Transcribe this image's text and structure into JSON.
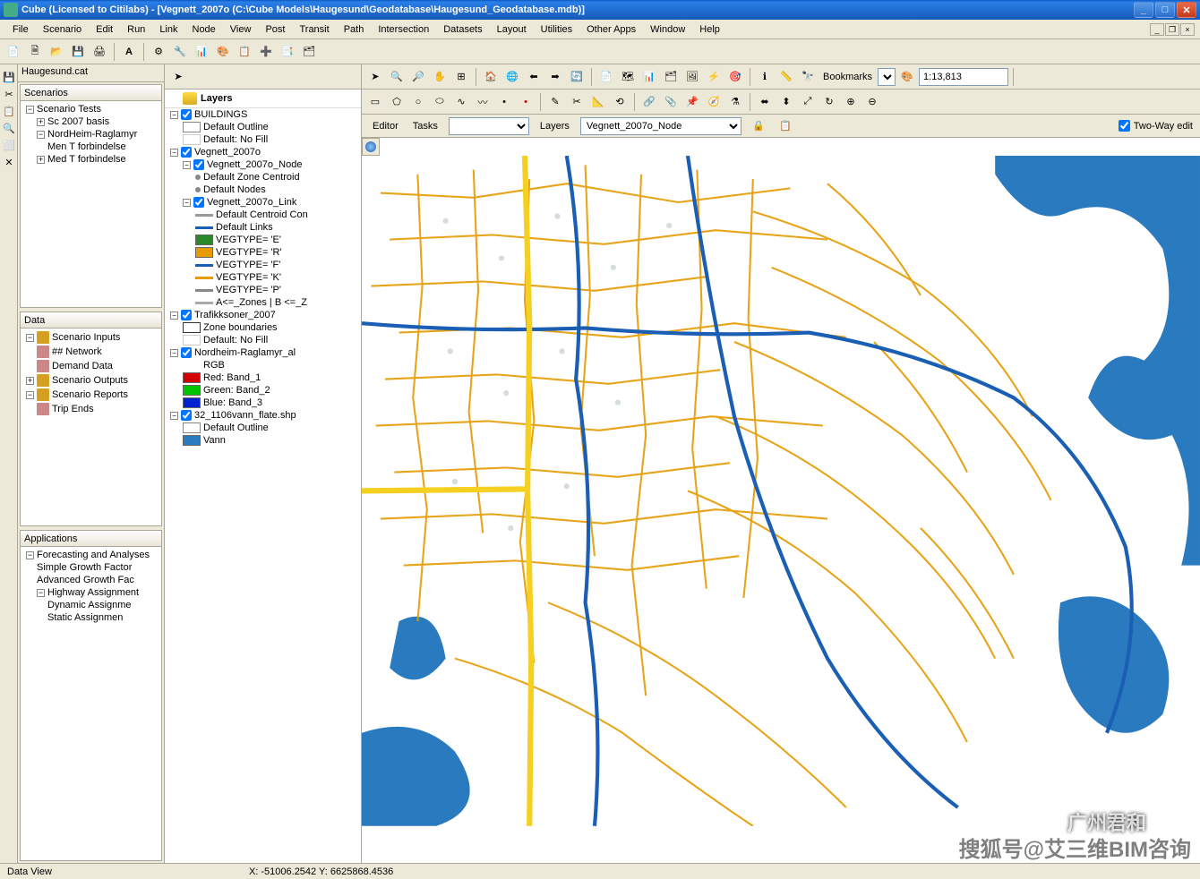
{
  "title": "Cube (Licensed to Citilabs) - [Vegnett_2007o (C:\\Cube Models\\Haugesund\\Geodatabase\\Haugesund_Geodatabase.mdb)]",
  "menus": [
    "File",
    "Scenario",
    "Edit",
    "Run",
    "Link",
    "Node",
    "View",
    "Post",
    "Transit",
    "Path",
    "Intersection",
    "Datasets",
    "Layout",
    "Utilities",
    "Other Apps",
    "Window",
    "Help"
  ],
  "tab_left": "Haugesund.cat",
  "scenarios": {
    "header": "Scenarios",
    "root": "Scenario Tests",
    "items": [
      "Sc 2007 basis",
      "NordHeim-Raglamyr",
      "Men T forbindelse",
      "Med T forbindelse"
    ]
  },
  "data_panel": {
    "header": "Data",
    "items": [
      "Scenario Inputs",
      "## Network",
      "Demand Data",
      "Scenario Outputs",
      "Scenario Reports",
      "Trip Ends"
    ]
  },
  "apps_panel": {
    "header": "Applications",
    "root": "Forecasting and Analyses",
    "items": [
      "Simple Growth Factor",
      "Advanced Growth Fac",
      "Highway Assignment",
      "Dynamic Assignme",
      "Static Assignmen"
    ]
  },
  "editor_label": "Editor",
  "tasks_label": "Tasks",
  "tasks_value": "",
  "layers_label": "Layers",
  "layers_value": "Vegnett_2007o_Node",
  "twoway_label": "Two-Way edit",
  "bookmarks_label": "Bookmarks",
  "scale_value": "1:13,813",
  "layers_tree": {
    "title": "Layers",
    "nodes": [
      {
        "type": "group",
        "label": "BUILDINGS",
        "checked": true,
        "children": [
          {
            "type": "sym",
            "label": "Default Outline",
            "swatch": "#fff",
            "border": "#888"
          },
          {
            "type": "sym",
            "label": "Default: No Fill",
            "swatch": "#fff",
            "border": "#ccc"
          }
        ]
      },
      {
        "type": "group",
        "label": "Vegnett_2007o",
        "checked": true,
        "children": [
          {
            "type": "group",
            "label": "Vegnett_2007o_Node",
            "checked": true,
            "children": [
              {
                "type": "sym",
                "label": "Default Zone Centroid",
                "dot": "#888"
              },
              {
                "type": "sym",
                "label": "Default Nodes",
                "dot": "#888"
              }
            ]
          },
          {
            "type": "group",
            "label": "Vegnett_2007o_Link",
            "checked": true,
            "children": [
              {
                "type": "sym",
                "label": "Default Centroid Con",
                "line": "#999"
              },
              {
                "type": "sym",
                "label": "Default Links",
                "line": "#1a5fb4"
              },
              {
                "type": "sym",
                "label": "VEGTYPE= 'E'",
                "swatch": "#2a8a2a"
              },
              {
                "type": "sym",
                "label": "VEGTYPE= 'R'",
                "swatch": "#e69b00"
              },
              {
                "type": "sym",
                "label": "VEGTYPE= 'F'",
                "line": "#1a5fb4"
              },
              {
                "type": "sym",
                "label": "VEGTYPE= 'K'",
                "line": "#e69b00"
              },
              {
                "type": "sym",
                "label": "VEGTYPE= 'P'",
                "line": "#888"
              },
              {
                "type": "sym",
                "label": "A<=_Zones | B <=_Z",
                "line": "#aaa"
              }
            ]
          }
        ]
      },
      {
        "type": "group",
        "label": "Trafikksoner_2007",
        "checked": true,
        "children": [
          {
            "type": "sym",
            "label": "Zone boundaries",
            "swatch": "#fff",
            "border": "#333"
          },
          {
            "type": "sym",
            "label": "Default: No Fill",
            "swatch": "#fff",
            "border": "#ccc"
          }
        ]
      },
      {
        "type": "group",
        "label": "Nordheim-Raglamyr_al",
        "checked": true,
        "children": [
          {
            "type": "sym",
            "label": "RGB"
          },
          {
            "type": "sym",
            "label": "Red:  Band_1",
            "swatch": "#d40000"
          },
          {
            "type": "sym",
            "label": "Green: Band_2",
            "swatch": "#00c400"
          },
          {
            "type": "sym",
            "label": "Blue:  Band_3",
            "swatch": "#0020d4"
          }
        ]
      },
      {
        "type": "group",
        "label": "32_1106vann_flate.shp",
        "checked": true,
        "children": [
          {
            "type": "sym",
            "label": "Default Outline",
            "swatch": "#fff",
            "border": "#888"
          },
          {
            "type": "sym",
            "label": "Vann",
            "swatch": "#2a7ac0"
          }
        ]
      }
    ]
  },
  "status_coords": "X: -51006.2542 Y: 6625868.4536",
  "status_tab": "Data View",
  "watermark1": "搜狐号@艾三维BIM咨询",
  "watermark2": "广州君和"
}
